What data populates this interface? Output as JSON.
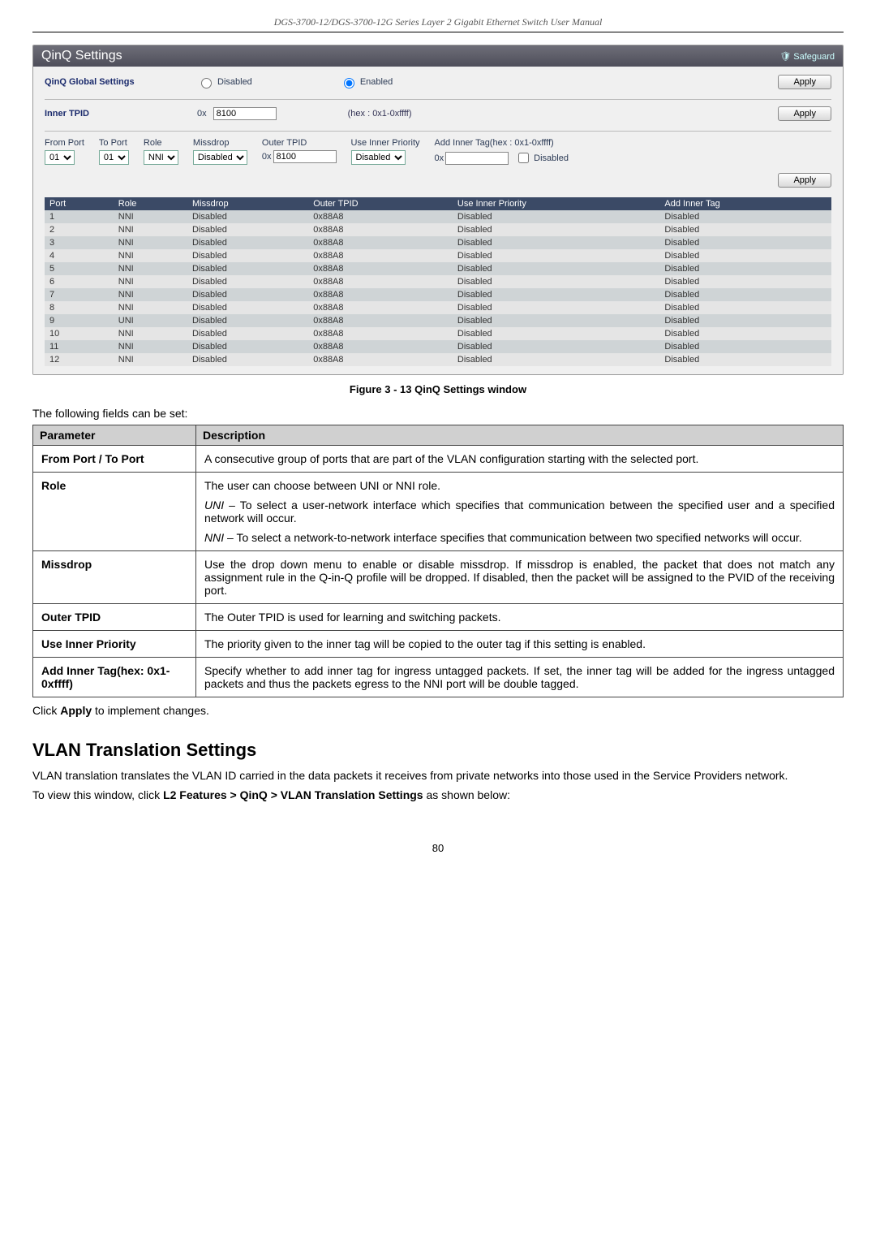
{
  "doc_header": "DGS-3700-12/DGS-3700-12G Series Layer 2 Gigabit Ethernet Switch User Manual",
  "panel": {
    "title": "QinQ Settings",
    "safeguard": "Safeguard",
    "global_label": "QinQ Global Settings",
    "disabled_label": "Disabled",
    "enabled_label": "Enabled",
    "apply_label": "Apply",
    "inner_tpid_label": "Inner TPID",
    "inner_tpid_prefix": "0x",
    "inner_tpid_value": "8100",
    "hex_note": "(hex : 0x1-0xffff)",
    "cfg": {
      "from_port": {
        "label": "From Port",
        "value": "01"
      },
      "to_port": {
        "label": "To Port",
        "value": "01"
      },
      "role": {
        "label": "Role",
        "value": "NNI"
      },
      "missdrop": {
        "label": "Missdrop",
        "value": "Disabled"
      },
      "outer_tpid": {
        "label": "Outer TPID",
        "prefix": "0x",
        "value": "8100"
      },
      "use_inner": {
        "label": "Use Inner Priority",
        "value": "Disabled"
      },
      "add_inner": {
        "label": "Add Inner Tag(hex : 0x1-0xffff)",
        "prefix": "0x",
        "chk": "Disabled"
      }
    },
    "table": {
      "headers": {
        "port": "Port",
        "role": "Role",
        "missdrop": "Missdrop",
        "outer": "Outer TPID",
        "use": "Use Inner Priority",
        "add": "Add Inner Tag"
      },
      "rows": [
        {
          "port": "1",
          "role": "NNI",
          "miss": "Disabled",
          "outer": "0x88A8",
          "use": "Disabled",
          "add": "Disabled"
        },
        {
          "port": "2",
          "role": "NNI",
          "miss": "Disabled",
          "outer": "0x88A8",
          "use": "Disabled",
          "add": "Disabled"
        },
        {
          "port": "3",
          "role": "NNI",
          "miss": "Disabled",
          "outer": "0x88A8",
          "use": "Disabled",
          "add": "Disabled"
        },
        {
          "port": "4",
          "role": "NNI",
          "miss": "Disabled",
          "outer": "0x88A8",
          "use": "Disabled",
          "add": "Disabled"
        },
        {
          "port": "5",
          "role": "NNI",
          "miss": "Disabled",
          "outer": "0x88A8",
          "use": "Disabled",
          "add": "Disabled"
        },
        {
          "port": "6",
          "role": "NNI",
          "miss": "Disabled",
          "outer": "0x88A8",
          "use": "Disabled",
          "add": "Disabled"
        },
        {
          "port": "7",
          "role": "NNI",
          "miss": "Disabled",
          "outer": "0x88A8",
          "use": "Disabled",
          "add": "Disabled"
        },
        {
          "port": "8",
          "role": "NNI",
          "miss": "Disabled",
          "outer": "0x88A8",
          "use": "Disabled",
          "add": "Disabled"
        },
        {
          "port": "9",
          "role": "UNI",
          "miss": "Disabled",
          "outer": "0x88A8",
          "use": "Disabled",
          "add": "Disabled"
        },
        {
          "port": "10",
          "role": "NNI",
          "miss": "Disabled",
          "outer": "0x88A8",
          "use": "Disabled",
          "add": "Disabled"
        },
        {
          "port": "11",
          "role": "NNI",
          "miss": "Disabled",
          "outer": "0x88A8",
          "use": "Disabled",
          "add": "Disabled"
        },
        {
          "port": "12",
          "role": "NNI",
          "miss": "Disabled",
          "outer": "0x88A8",
          "use": "Disabled",
          "add": "Disabled"
        }
      ]
    }
  },
  "caption": "Figure 3 - 13 QinQ Settings window",
  "intro": "The following fields can be set:",
  "desc_header": {
    "param": "Parameter",
    "desc": "Description"
  },
  "desc_rows": {
    "fromto": {
      "k": "From Port / To Port",
      "v": "A consecutive group of ports that are part of the VLAN configuration starting with the selected port."
    },
    "role": {
      "k": "Role",
      "line1": "The user can choose between UNI or NNI role.",
      "uni_k": "UNI",
      "uni_v": " – To select a user-network interface which specifies that communication between the specified user and a specified network will occur.",
      "nni_k": "NNI",
      "nni_v": " – To select a network-to-network interface specifies that communication between two specified networks will occur."
    },
    "miss": {
      "k": "Missdrop",
      "v": "Use the drop down menu to enable or disable missdrop. If missdrop is enabled, the packet that does not match any assignment rule in the Q-in-Q profile will be dropped. If disabled, then the packet will be assigned to the PVID of the receiving port."
    },
    "outer": {
      "k": "Outer TPID",
      "v": "The Outer TPID is used for learning and switching packets."
    },
    "use": {
      "k": "Use Inner Priority",
      "v": "The priority given to the inner tag will be copied to the outer tag if this setting is enabled."
    },
    "add": {
      "k": "Add Inner Tag(hex: 0x1-0xffff)",
      "v": "Specify whether to add inner tag for ingress untagged packets. If set, the inner tag will be added for the ingress untagged packets and thus the packets egress to the NNI port will be double tagged."
    }
  },
  "click_apply_pre": "Click ",
  "click_apply_bold": "Apply",
  "click_apply_post": " to implement changes.",
  "section_title": "VLAN Translation Settings",
  "section_p1": "VLAN translation translates the VLAN ID carried in the data packets it receives from private networks into those used in the Service Providers network.",
  "section_p2_pre": "To view this window, click ",
  "section_p2_bold": "L2 Features > QinQ > VLAN Translation Settings",
  "section_p2_post": " as shown below:",
  "pagenum": "80"
}
